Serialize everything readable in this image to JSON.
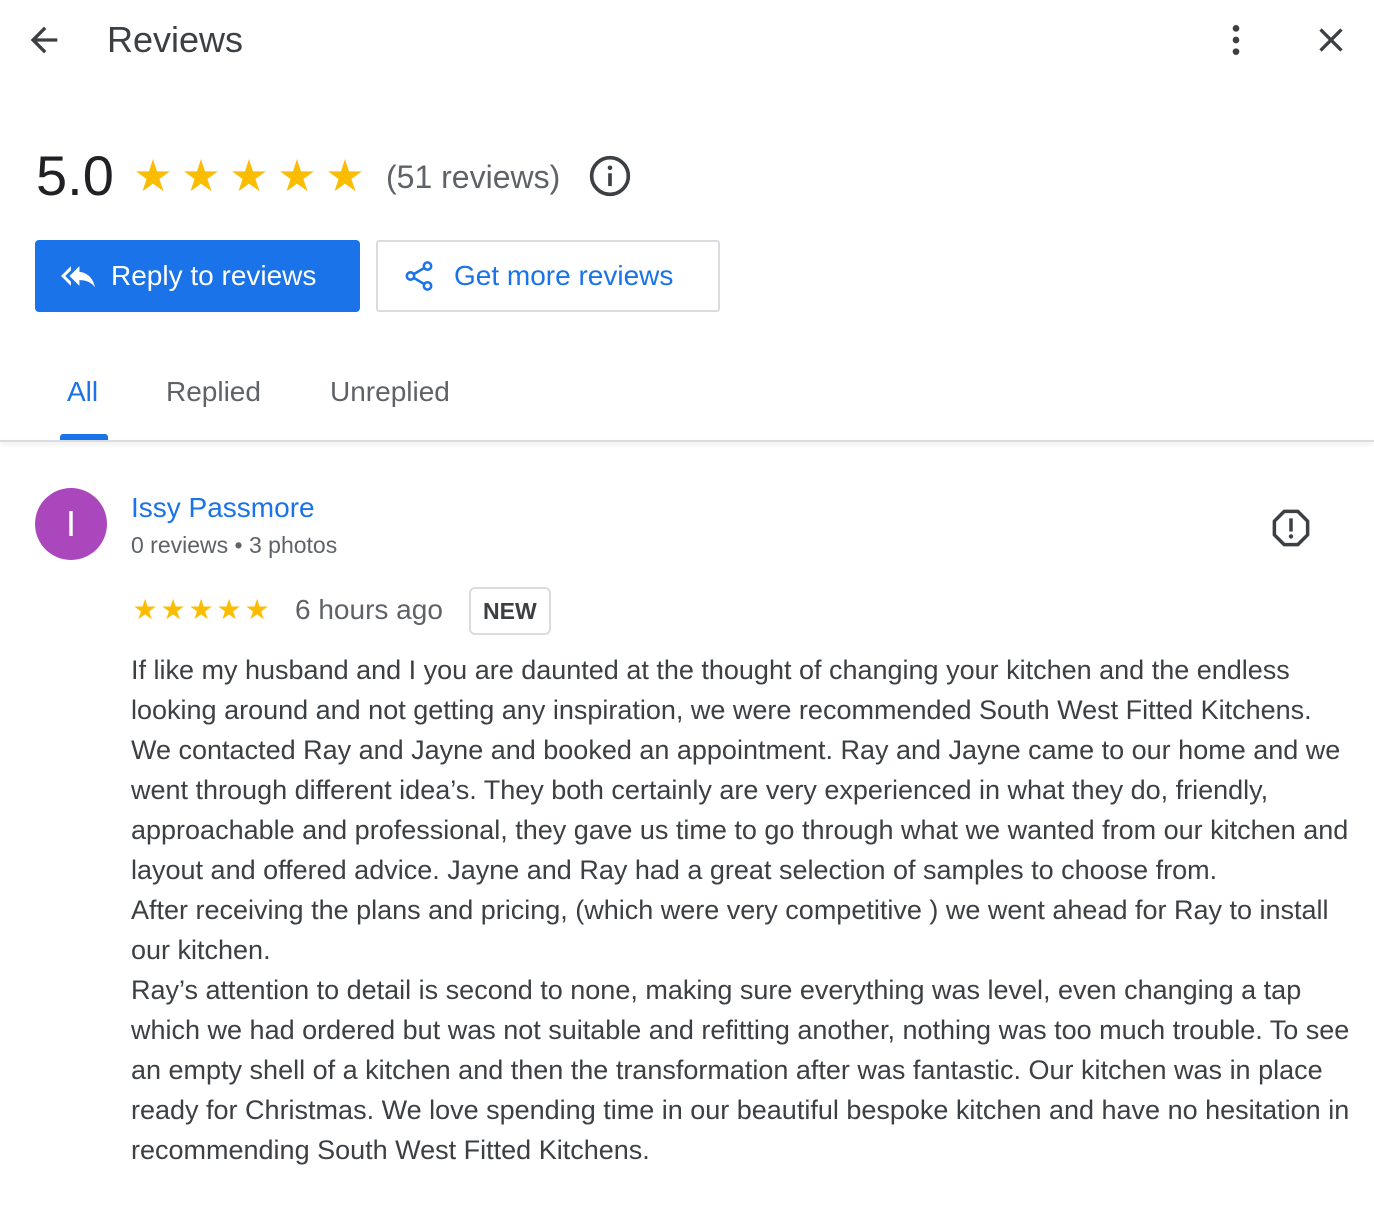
{
  "header": {
    "title": "Reviews",
    "back_icon": "arrow-left-icon",
    "more_icon": "more-vertical-icon",
    "close_icon": "close-icon"
  },
  "summary": {
    "score": "5.0",
    "stars": 5,
    "review_count": "(51 reviews)",
    "info_icon": "info-icon"
  },
  "actions": {
    "reply": {
      "label": "Reply to reviews",
      "icon": "reply-all-icon"
    },
    "get_more": {
      "label": "Get more reviews",
      "icon": "share-icon"
    }
  },
  "tabs": [
    {
      "label": "All",
      "active": true
    },
    {
      "label": "Replied",
      "active": false
    },
    {
      "label": "Unreplied",
      "active": false
    }
  ],
  "review": {
    "avatar_initial": "I",
    "reviewer": "Issy Passmore",
    "meta": "0 reviews • 3 photos",
    "rating": 5,
    "time": "6 hours ago",
    "badge": "NEW",
    "report_icon": "report-icon",
    "paragraphs": [
      "If like my husband and I you are daunted at the thought of changing your kitchen and the endless looking around and not getting any inspiration, we were recommended South West Fitted Kitchens. We contacted Ray and Jayne and booked an appointment. Ray and Jayne came to our home and we went through different idea’s. They both certainly are very experienced in what they do, friendly, approachable and professional, they gave us time to go through what we wanted from our kitchen and layout and offered advice. Jayne and Ray had a great selection of samples to choose from.",
      "After receiving the plans and pricing, (which were very competitive ) we went ahead for Ray to install our kitchen.",
      "Ray’s attention to detail is second to none, making sure everything was level, even changing a tap which we had ordered but was not suitable and refitting another, nothing was too much trouble. To see an empty shell of a kitchen and then the transformation after was fantastic. Our kitchen was in place ready for Christmas. We love spending time in our beautiful bespoke kitchen and have no hesitation in recommending South West Fitted Kitchens."
    ]
  },
  "colors": {
    "accent": "#1a73e8",
    "star": "#fbbc04",
    "avatar": "#ab47bc"
  }
}
